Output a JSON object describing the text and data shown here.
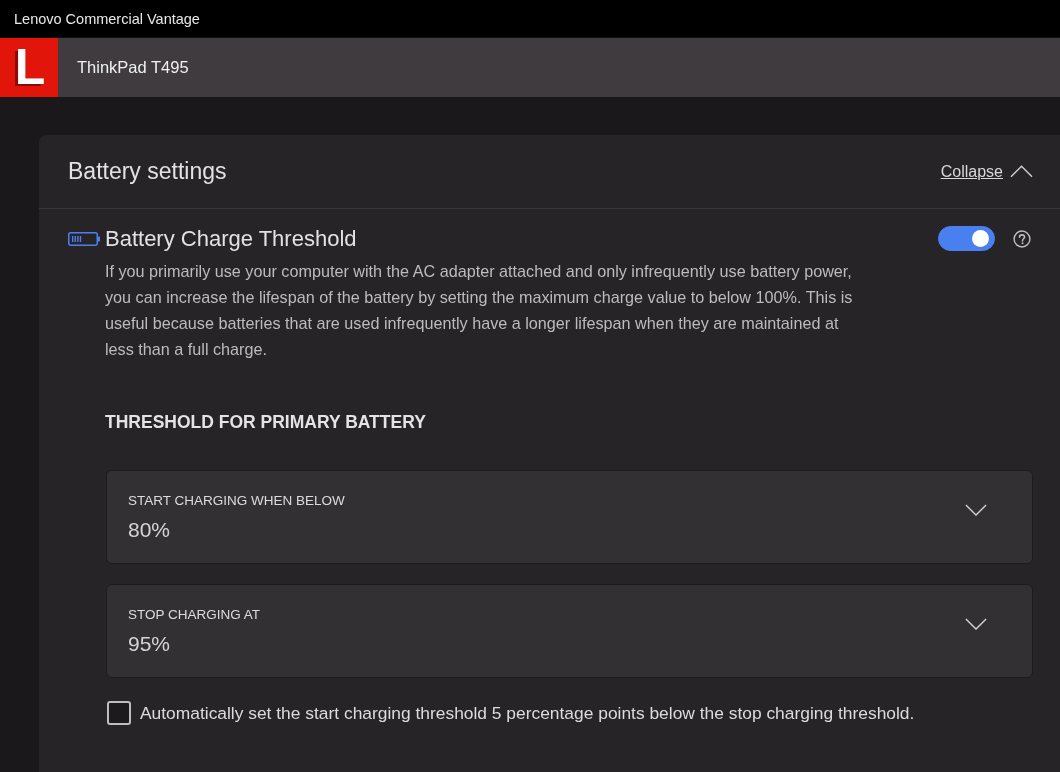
{
  "window": {
    "title": "Lenovo Commercial Vantage"
  },
  "header": {
    "logo_letter": "L",
    "device_name": "ThinkPad T495"
  },
  "battery_settings": {
    "title": "Battery settings",
    "collapse_link": "Collapse",
    "expanded": true,
    "charge_threshold": {
      "title": "Battery Charge Threshold",
      "on": true,
      "description": "If you primarily use your computer with the AC adapter attached and only infrequently use battery power, you can increase the lifespan of the battery by setting the maximum charge value to below 100%. This is useful because batteries that are used infrequently have a longer lifespan when they are maintained at less than a full charge.",
      "section_heading": "THRESHOLD FOR PRIMARY BATTERY",
      "dropdowns": [
        {
          "label": "START CHARGING WHEN BELOW",
          "value": "80%"
        },
        {
          "label": "STOP CHARGING AT",
          "value": "95%"
        }
      ],
      "auto_option": {
        "label": "Automatically set the start charging threshold 5 percentage points below the stop charging threshold.",
        "checked": false
      }
    }
  }
}
